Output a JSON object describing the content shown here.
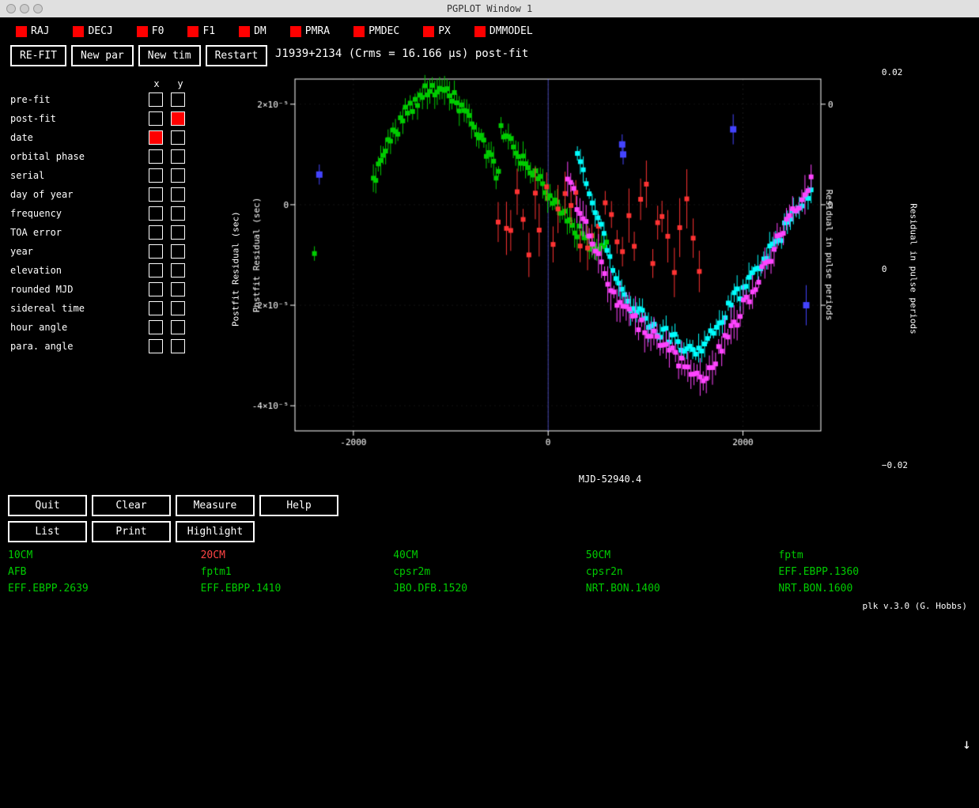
{
  "titlebar": {
    "title": "PGPLOT Window 1",
    "icon": "✕"
  },
  "top_params": [
    {
      "label": "RAJ",
      "color": "red"
    },
    {
      "label": "DECJ",
      "color": "red"
    },
    {
      "label": "F0",
      "color": "red"
    },
    {
      "label": "F1",
      "color": "red"
    },
    {
      "label": "DM",
      "color": "red"
    },
    {
      "label": "PMRA",
      "color": "red"
    },
    {
      "label": "PMDEC",
      "color": "red"
    },
    {
      "label": "PX",
      "color": "red"
    },
    {
      "label": "DMMODEL",
      "color": "red"
    }
  ],
  "toolbar": {
    "refit_label": "RE-FIT",
    "newpar_label": "New par",
    "newtim_label": "New tim",
    "restart_label": "Restart"
  },
  "plot_title": "J1939+2134 (Crms = 16.166 μs) post-fit",
  "param_grid": {
    "header": {
      "x": "x",
      "y": "y"
    },
    "rows": [
      {
        "name": "pre-fit",
        "x_filled": false,
        "y_filled": false
      },
      {
        "name": "post-fit",
        "x_filled": false,
        "y_filled": true
      },
      {
        "name": "date",
        "x_filled": true,
        "y_filled": false
      },
      {
        "name": "orbital phase",
        "x_filled": false,
        "y_filled": false
      },
      {
        "name": "serial",
        "x_filled": false,
        "y_filled": false
      },
      {
        "name": "day of year",
        "x_filled": false,
        "y_filled": false
      },
      {
        "name": "frequency",
        "x_filled": false,
        "y_filled": false
      },
      {
        "name": "TOA error",
        "x_filled": false,
        "y_filled": false
      },
      {
        "name": "year",
        "x_filled": false,
        "y_filled": false
      },
      {
        "name": "elevation",
        "x_filled": false,
        "y_filled": false
      },
      {
        "name": "rounded MJD",
        "x_filled": false,
        "y_filled": false
      },
      {
        "name": "sidereal time",
        "x_filled": false,
        "y_filled": false
      },
      {
        "name": "hour angle",
        "x_filled": false,
        "y_filled": false
      },
      {
        "name": "para. angle",
        "x_filled": false,
        "y_filled": false
      }
    ]
  },
  "chart": {
    "y_axis_left": "Postfit Residual (sec)",
    "y_axis_right": "Residual in pulse periods",
    "x_axis_label": "MJD-52940.4",
    "y_ticks_left": [
      "2×10⁻⁵",
      "0",
      "-2×10⁻⁵",
      "-4×10⁻⁵"
    ],
    "y_ticks_right": [
      "0.02",
      "0",
      "-0.02"
    ],
    "x_ticks": [
      "-2000",
      "0",
      "2000"
    ]
  },
  "bottom_buttons": {
    "row1": [
      "Quit",
      "Clear",
      "Measure",
      "Help"
    ],
    "row2": [
      "List",
      "Print",
      "Highlight"
    ]
  },
  "legend": [
    {
      "label": "10CM",
      "color": "green"
    },
    {
      "label": "20CM",
      "color": "red"
    },
    {
      "label": "40CM",
      "color": "green"
    },
    {
      "label": "50CM",
      "color": "green"
    },
    {
      "label": "fptm",
      "color": "green"
    },
    {
      "label": "AFB",
      "color": "green"
    },
    {
      "label": "fptm1",
      "color": "green"
    },
    {
      "label": "cpsr2m",
      "color": "green"
    },
    {
      "label": "cpsr2n",
      "color": "green"
    },
    {
      "label": "EFF.EBPP.1360",
      "color": "green"
    },
    {
      "label": "EFF.EBPP.2639",
      "color": "green"
    },
    {
      "label": "EFF.EBPP.1410",
      "color": "green"
    },
    {
      "label": "JBO.DFB.1520",
      "color": "green"
    },
    {
      "label": "NRT.BON.1400",
      "color": "green"
    },
    {
      "label": "NRT.BON.1600",
      "color": "green"
    }
  ],
  "plk_version": "plk v.3.0 (G. Hobbs)"
}
